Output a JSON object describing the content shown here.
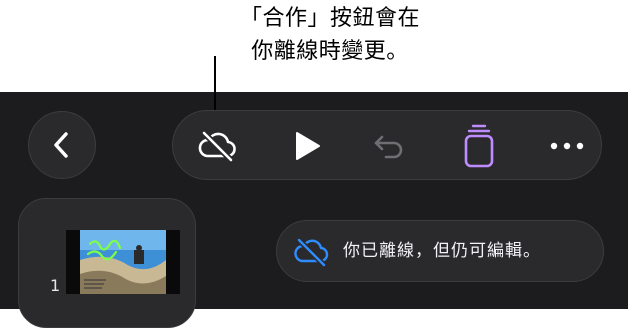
{
  "callout": {
    "line1": "「合作」按鈕會在",
    "line2": "你離線時變更。"
  },
  "toolbar": {
    "back_icon": "chevron-left-icon",
    "collaborate_icon": "cloud-slash-icon",
    "play_icon": "play-icon",
    "undo_icon": "undo-icon",
    "slides_icon": "stacked-slides-icon",
    "more_icon": "ellipsis-icon"
  },
  "slides": [
    {
      "number": "1"
    }
  ],
  "offline_banner": {
    "icon": "cloud-slash-icon",
    "text": "你已離線，但仍可編輯。"
  },
  "colors": {
    "background": "#1c1c1e",
    "pill": "#2a2a2c",
    "icon": "#ffffff",
    "disabled_icon": "#6e6e73",
    "accent_purple": "#bf8cff",
    "offline_blue": "#2e8cff"
  }
}
